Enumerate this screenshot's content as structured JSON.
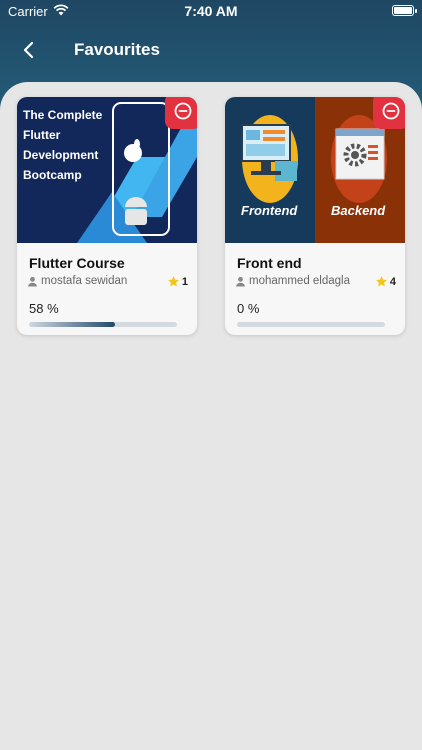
{
  "status_bar": {
    "carrier": "Carrier",
    "time": "7:40 AM"
  },
  "header": {
    "title": "Favourites"
  },
  "courses": [
    {
      "thumb_lines": [
        "The Complete",
        "Flutter",
        "Development",
        "Bootcamp"
      ],
      "title": "Flutter Course",
      "author": "mostafa sewidan",
      "rating": "1",
      "progress_text": "58 %",
      "progress": 0.58
    },
    {
      "thumb_left": "Frontend",
      "thumb_right": "Backend",
      "title": "Front end",
      "author": "mohammed eldagla",
      "rating": "4",
      "progress_text": "0 %",
      "progress": 0
    }
  ],
  "colors": {
    "header": "#1f4f6a",
    "remove": "#e2313f",
    "star": "#f5c518"
  }
}
